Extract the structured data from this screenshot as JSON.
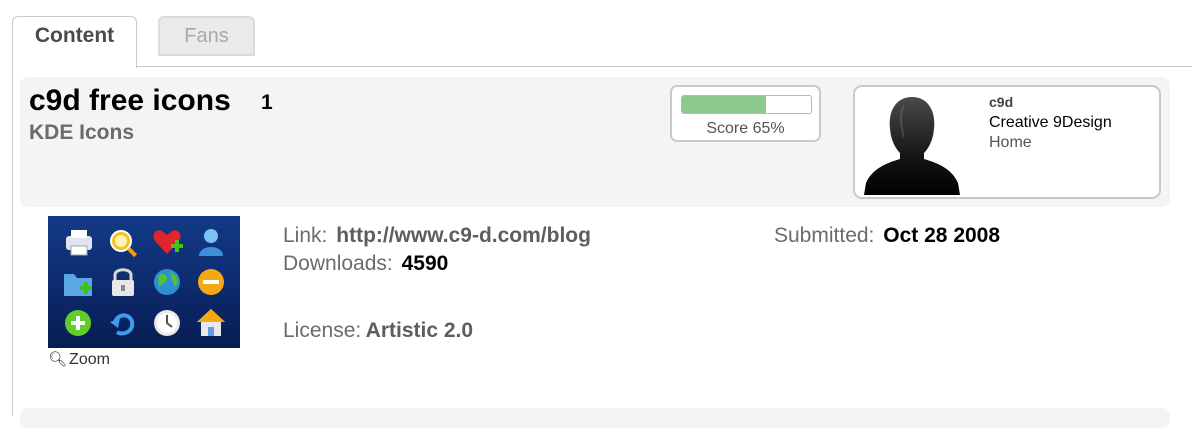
{
  "tabs": [
    {
      "label": "Content",
      "active": true
    },
    {
      "label": "Fans",
      "active": false
    }
  ],
  "item": {
    "title": "c9d free icons",
    "count": "1",
    "category": "KDE Icons"
  },
  "score": {
    "label": "Score 65%",
    "fraction": 0.65,
    "fill_color": "#8dc98a"
  },
  "user": {
    "username": "c9d",
    "full_name": "Creative 9Design",
    "home_link": "Home",
    "avatar_icon": "user-silhouette-icon"
  },
  "preview": {
    "zoom_label": "Zoom",
    "zoom_icon": "magnifier-icon",
    "icons": [
      "printer-icon",
      "search-icon",
      "heart-plus-icon",
      "user-icon",
      "folder-add-icon",
      "lock-icon",
      "globe-icon",
      "minus-icon",
      "add-icon",
      "undo-icon",
      "clock-icon",
      "home-icon"
    ]
  },
  "details": {
    "link_label": "Link:",
    "link_value": "http://www.c9-d.com/blog",
    "downloads_label": "Downloads:",
    "downloads_value": "4590",
    "license_label": "License:",
    "license_value": "Artistic 2.0",
    "submitted_label": "Submitted:",
    "submitted_value": "Oct 28 2008"
  }
}
